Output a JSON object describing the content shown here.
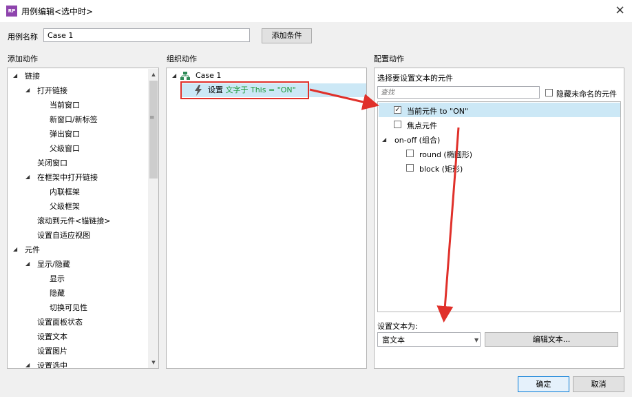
{
  "window": {
    "app_icon": "RP",
    "title": "用例编辑<选中时>",
    "close_icon": "×"
  },
  "case_name": {
    "label": "用例名称",
    "value": "Case 1",
    "add_condition_label": "添加条件"
  },
  "add_actions": {
    "title": "添加动作",
    "items": [
      {
        "label": "链接"
      },
      {
        "label": "打开链接"
      },
      {
        "label": "当前窗口"
      },
      {
        "label": "新窗口/新标签"
      },
      {
        "label": "弹出窗口"
      },
      {
        "label": "父级窗口"
      },
      {
        "label": "关闭窗口"
      },
      {
        "label": "在框架中打开链接"
      },
      {
        "label": "内联框架"
      },
      {
        "label": "父级框架"
      },
      {
        "label": "滚动到元件<锚链接>"
      },
      {
        "label": "设置自适应视图"
      },
      {
        "label": "元件"
      },
      {
        "label": "显示/隐藏"
      },
      {
        "label": "显示"
      },
      {
        "label": "隐藏"
      },
      {
        "label": "切换可见性"
      },
      {
        "label": "设置面板状态"
      },
      {
        "label": "设置文本"
      },
      {
        "label": "设置图片"
      },
      {
        "label": "设置选中"
      }
    ]
  },
  "organize_actions": {
    "title": "组织动作",
    "case_label": "Case 1",
    "action_prefix": "设置",
    "action_detail": "文字于 This = \"ON\""
  },
  "configure_actions": {
    "title": "配置动作",
    "select_label": "选择要设置文本的元件",
    "search_placeholder": "查找",
    "hide_unnamed_label": "隐藏未命名的元件",
    "hide_unnamed_checked": false,
    "widgets": [
      {
        "label": "当前元件 to \"ON\"",
        "checked": true
      },
      {
        "label": "焦点元件",
        "checked": false
      },
      {
        "label": "on-off (组合)"
      },
      {
        "label": "round (椭圆形)",
        "checked": false
      },
      {
        "label": "block (矩形)",
        "checked": false
      }
    ],
    "set_text_label": "设置文本为:",
    "text_type": "富文本",
    "edit_text_label": "编辑文本..."
  },
  "footer": {
    "ok_label": "确定",
    "cancel_label": "取消"
  },
  "colors": {
    "highlight_row": "#cce8f6",
    "annotation_red": "#e0302a",
    "action_green": "#1f9a3c"
  }
}
